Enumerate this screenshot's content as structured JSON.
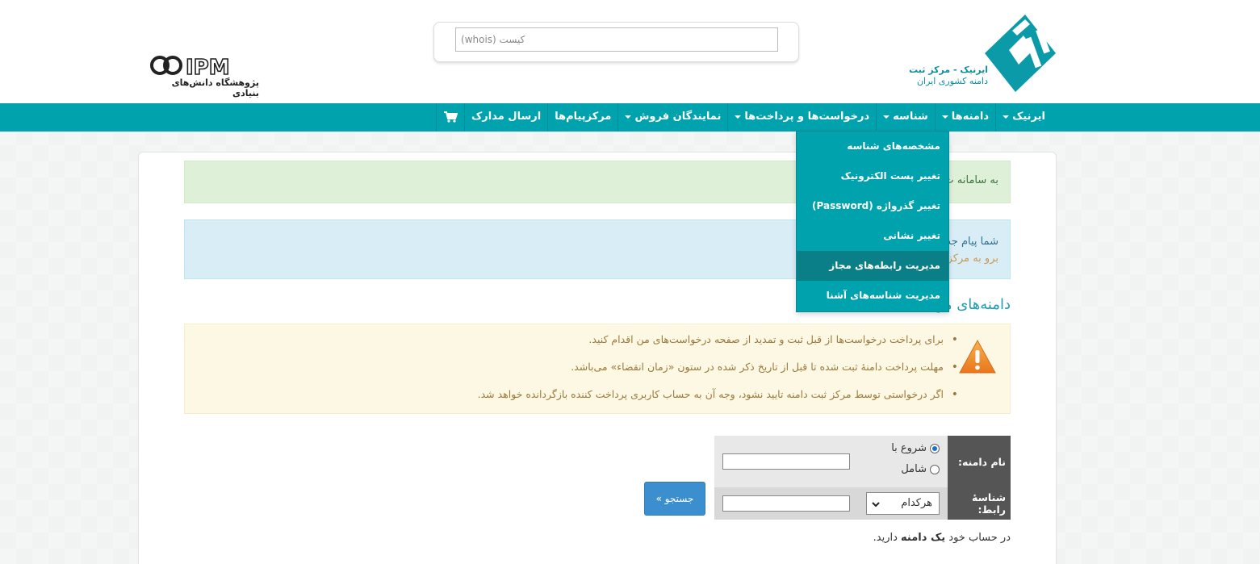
{
  "header": {
    "search_placeholder": "کیست (whois)",
    "irnic_logo_text_line1": "ایرنیک - مرکز ثبت",
    "irnic_logo_text_line2": "دامنه کشوری ایران",
    "ipm_logo_text": "IPM",
    "ipm_caption": "پژوهشگاه دانش‌های بنیادی"
  },
  "nav": {
    "items": [
      {
        "label": "ایرنیک",
        "has_caret": true
      },
      {
        "label": "دامنه‌ها",
        "has_caret": true
      },
      {
        "label": "شناسه",
        "has_caret": true
      },
      {
        "label": "درخواست‌ها و پرداخت‌ها",
        "has_caret": true
      },
      {
        "label": "نمایندگان فروش",
        "has_caret": true
      },
      {
        "label": "مرکزپیام‌ها",
        "has_caret": false
      },
      {
        "label": "ارسال مدارک",
        "has_caret": false
      }
    ],
    "cart_icon": "shopping-cart-icon"
  },
  "dropdown": {
    "items": [
      "مشخصه‌های شناسه",
      "تغییر پست الکترونیک",
      "تغییر گذرواژه (Password)",
      "تغییر نشانی",
      "مدیریت رابطه‌های مجاز",
      "مدیریت شناسه‌های آشنا"
    ],
    "highlighted_index": 4
  },
  "alerts": {
    "success_text": "به سامانه ث",
    "info_line1": "شما پیام جد",
    "info_line2": "برو به مرکز"
  },
  "section_title": "دامنه‌های من",
  "warning": {
    "icon": "warning-triangle-icon",
    "items": [
      "برای پرداخت درخواست‌ها از قبل ثبت و تمدید از صفحه درخواست‌های من اقدام کنید.",
      "مهلت پرداخت دامنهٔ ثبت شده تا قبل از تاریخ ذکر شده در ستون «زمان انقضاء» می‌باشد.",
      "اگر درخواستی توسط مرکز ثبت دامنه تایید نشود، وجه آن به حساب کاربری پرداخت کننده بازگردانده خواهد شد."
    ]
  },
  "form": {
    "domain_label": "نام دامنه:",
    "radio_starts_with": "شروع با",
    "radio_contains": "شامل",
    "nic_label": "شناسهٔ رابط:",
    "nic_select_value": "هرکدام",
    "search_button": "جستجو »"
  },
  "footer_note": {
    "prefix": "در حساب خود",
    "bold": "یک دامنه",
    "suffix": "دارید."
  },
  "colors": {
    "nav_bg": "#00a2ad",
    "dropdown_hover": "#0a7f88",
    "brand_teal": "#0b8f9f",
    "button_blue": "#3b8fce"
  }
}
